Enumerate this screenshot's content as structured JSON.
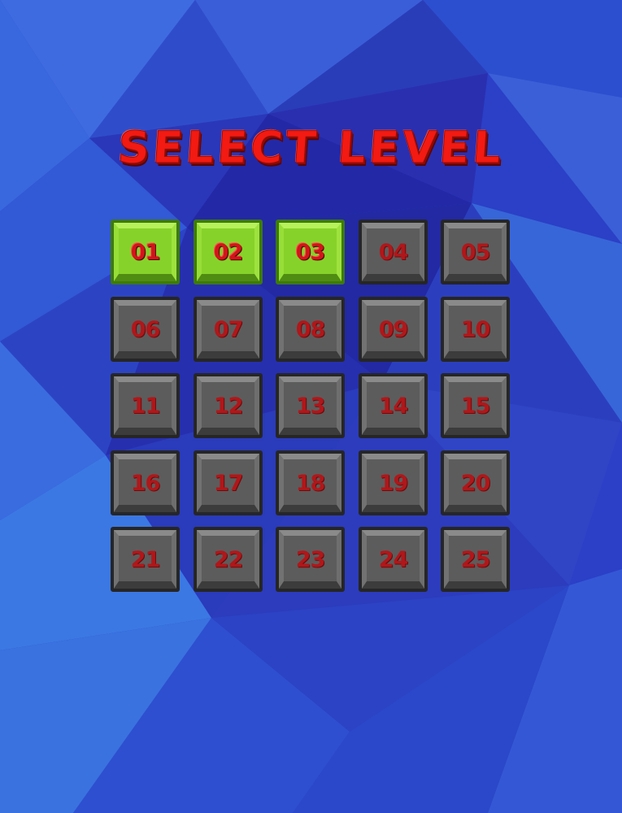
{
  "title": "SELECT LEVEL",
  "colors": {
    "background": "#2a3fc4",
    "title_red": "#f21a12",
    "unlocked_green": "#86d22a",
    "locked_gray": "#5c5c5c",
    "number_red": "#b0171a"
  },
  "levels": [
    {
      "label": "01",
      "unlocked": true
    },
    {
      "label": "02",
      "unlocked": true
    },
    {
      "label": "03",
      "unlocked": true
    },
    {
      "label": "04",
      "unlocked": false
    },
    {
      "label": "05",
      "unlocked": false
    },
    {
      "label": "06",
      "unlocked": false
    },
    {
      "label": "07",
      "unlocked": false
    },
    {
      "label": "08",
      "unlocked": false
    },
    {
      "label": "09",
      "unlocked": false
    },
    {
      "label": "10",
      "unlocked": false
    },
    {
      "label": "11",
      "unlocked": false
    },
    {
      "label": "12",
      "unlocked": false
    },
    {
      "label": "13",
      "unlocked": false
    },
    {
      "label": "14",
      "unlocked": false
    },
    {
      "label": "15",
      "unlocked": false
    },
    {
      "label": "16",
      "unlocked": false
    },
    {
      "label": "17",
      "unlocked": false
    },
    {
      "label": "18",
      "unlocked": false
    },
    {
      "label": "19",
      "unlocked": false
    },
    {
      "label": "20",
      "unlocked": false
    },
    {
      "label": "21",
      "unlocked": false
    },
    {
      "label": "22",
      "unlocked": false
    },
    {
      "label": "23",
      "unlocked": false
    },
    {
      "label": "24",
      "unlocked": false
    },
    {
      "label": "25",
      "unlocked": false
    }
  ]
}
